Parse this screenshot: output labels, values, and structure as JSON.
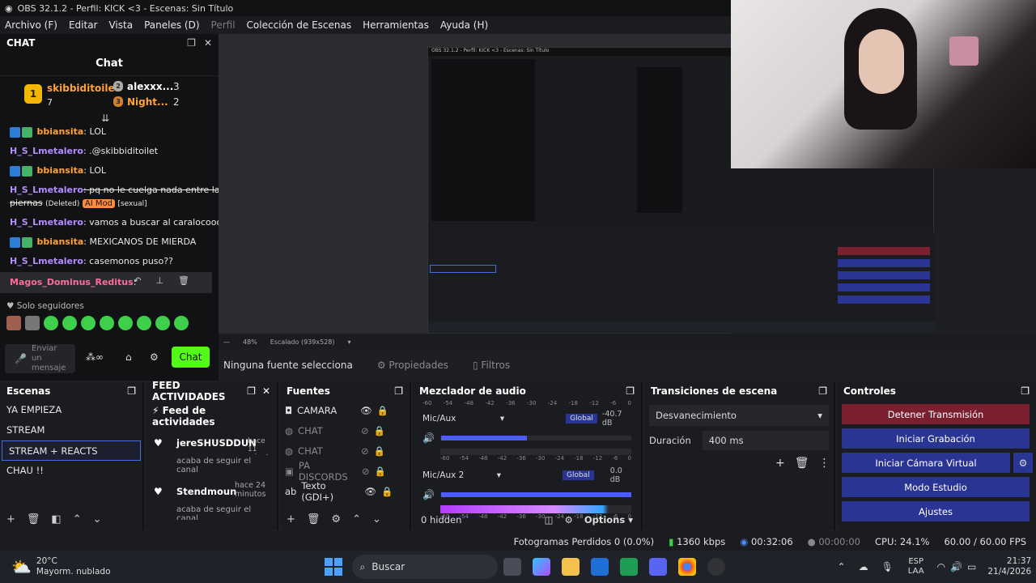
{
  "window": {
    "title": "OBS 32.1.2 - Perfil: KICK <3 - Escenas: Sin Título"
  },
  "menu": [
    "Archivo (F)",
    "Editar",
    "Vista",
    "Paneles (D)",
    "Perfil",
    "Colección de Escenas",
    "Herramientas",
    "Ayuda (H)"
  ],
  "chat": {
    "dock_title": "CHAT",
    "title": "Chat",
    "leaders": [
      {
        "rank": "1",
        "name": "skibbiditoilet",
        "count": "7"
      },
      {
        "rank": "2",
        "name": "alexxx...",
        "count": "3"
      },
      {
        "rank": "3",
        "name": "Night...",
        "count": "2"
      }
    ],
    "messages": [
      {
        "user": "bbiansita",
        "text": ": LOL"
      },
      {
        "user": "H_S_Lmetalero",
        "text": ": .@skibbiditoilet"
      },
      {
        "user": "bbiansita",
        "text": ": LOL"
      },
      {
        "user": "H_S_Lmetalero",
        "text": ": pq no le cuelga nada entre las"
      },
      {
        "user": "",
        "text": "piernas"
      },
      {
        "user": "H_S_Lmetalero",
        "text": ": vamos a buscar al caralocooo"
      },
      {
        "user": "bbiansita",
        "text": ": MEXICANOS DE MIERDA"
      },
      {
        "user": "H_S_Lmetalero",
        "text": ": casemonos puso??"
      },
      {
        "user": "Magos_Dominus_Reditus",
        "text": ":"
      }
    ],
    "deleted_label": "(Deleted)",
    "ai_mod": "AI Mod",
    "ai_tag": "[sexual]",
    "followers_only": "Solo seguidores",
    "input_placeholder": "Enviar un mensaje",
    "send": "Chat"
  },
  "preview": {
    "zoom": "48%",
    "scale": "Escalado (939x528)"
  },
  "source_bar": {
    "none": "Ninguna fuente selecciona",
    "props": "Propiedades",
    "filters": "Filtros"
  },
  "scenes": {
    "title": "Escenas",
    "items": [
      "YA EMPIEZA",
      "STREAM",
      "STREAM + REACTS",
      "CHAU !!"
    ]
  },
  "feed": {
    "title": "FEED ACTIVIDADES",
    "header": "Feed de actividades",
    "items": [
      {
        "name": "jereSHUSDDUN",
        "time": "hace 11 minutos",
        "text": "acaba de seguir el canal"
      },
      {
        "name": "Stendmoun",
        "time": "hace 24 minutos",
        "text": "acaba de seguir el canal"
      }
    ]
  },
  "sources": {
    "title": "Fuentes",
    "items": [
      "CAMARA",
      "CHAT",
      "CHAT",
      "PA DISCORDS",
      "Texto (GDI+)"
    ]
  },
  "mixer": {
    "title": "Mezclador de audio",
    "tracks": [
      {
        "name": "Mic/Aux",
        "tag": "Global",
        "db": "-40.7 dB"
      },
      {
        "name": "Mic/Aux 2",
        "tag": "Global",
        "db": "0.0 dB"
      }
    ],
    "ticks": [
      "-60",
      "-54",
      "-48",
      "-42",
      "-36",
      "-30",
      "-24",
      "-18",
      "-12",
      "-6",
      "0"
    ],
    "hidden": "0 hidden",
    "options": "Options"
  },
  "transitions": {
    "title": "Transiciones de escena",
    "type": "Desvanecimiento",
    "duration_label": "Duración",
    "duration": "400 ms"
  },
  "controls": {
    "title": "Controles",
    "buttons": [
      "Detener Transmisión",
      "Iniciar Grabación",
      "Iniciar Cámara Virtual",
      "Modo Estudio",
      "Ajustes"
    ]
  },
  "status": {
    "dropped": "Fotogramas Perdidos 0 (0.0%)",
    "kbps": "1360 kbps",
    "stream_time": "00:32:06",
    "rec_time": "00:00:00",
    "cpu": "CPU: 24.1%",
    "fps": "60.00 / 60.00 FPS"
  },
  "taskbar": {
    "temp": "20°C",
    "weather": "Mayorm. nublado",
    "search": "Buscar",
    "lang1": "ESP",
    "lang2": "LAA",
    "time": "21:37",
    "date": "21/4/2026"
  }
}
